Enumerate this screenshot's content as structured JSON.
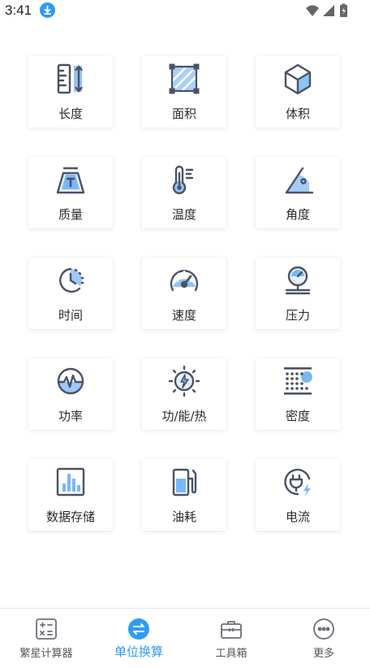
{
  "status": {
    "time": "3:41"
  },
  "units": [
    {
      "label": "长度",
      "icon": "ruler-icon"
    },
    {
      "label": "面积",
      "icon": "area-icon"
    },
    {
      "label": "体积",
      "icon": "cube-icon"
    },
    {
      "label": "质量",
      "icon": "weight-icon"
    },
    {
      "label": "温度",
      "icon": "thermometer-icon"
    },
    {
      "label": "角度",
      "icon": "angle-icon"
    },
    {
      "label": "时间",
      "icon": "clock-icon"
    },
    {
      "label": "速度",
      "icon": "speedometer-icon"
    },
    {
      "label": "压力",
      "icon": "pressure-gauge-icon"
    },
    {
      "label": "功率",
      "icon": "power-icon"
    },
    {
      "label": "功/能/热",
      "icon": "energy-icon"
    },
    {
      "label": "密度",
      "icon": "density-icon"
    },
    {
      "label": "数据存储",
      "icon": "data-storage-icon"
    },
    {
      "label": "油耗",
      "icon": "fuel-pump-icon"
    },
    {
      "label": "电流",
      "icon": "current-plug-icon"
    }
  ],
  "tabs": [
    {
      "label": "繁星计算器",
      "icon": "calculator-icon",
      "active": false
    },
    {
      "label": "单位换算",
      "icon": "swap-icon",
      "active": true
    },
    {
      "label": "工具箱",
      "icon": "toolbox-icon",
      "active": false
    },
    {
      "label": "更多",
      "icon": "more-icon",
      "active": false
    }
  ],
  "colors": {
    "accent": "#2f9bf5",
    "icon_stroke": "#4a5265",
    "icon_fill": "#7ab8f5"
  }
}
